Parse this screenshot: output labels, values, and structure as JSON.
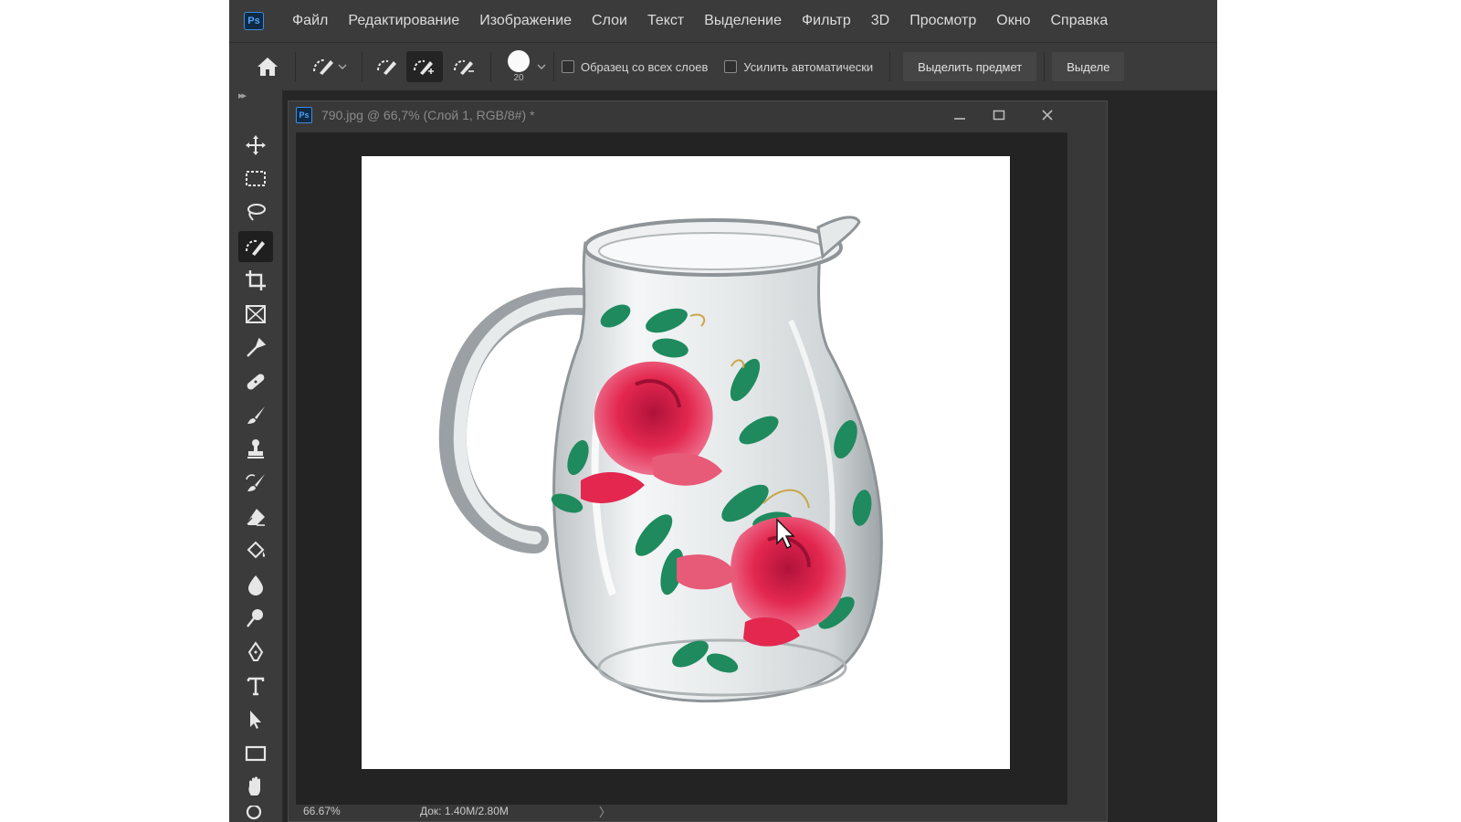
{
  "app": {
    "logo": "Ps"
  },
  "menu": [
    "Файл",
    "Редактирование",
    "Изображение",
    "Слои",
    "Текст",
    "Выделение",
    "Фильтр",
    "3D",
    "Просмотр",
    "Окно",
    "Справка"
  ],
  "options": {
    "brush_size": "20",
    "sample_all_layers": "Образец со всех слоев",
    "auto_enhance": "Усилить автоматически",
    "select_subject": "Выделить предмет",
    "select_mask": "Выделе"
  },
  "tools": [
    "move",
    "marquee",
    "lasso",
    "quick-selection",
    "crop",
    "frame",
    "eyedropper",
    "healing-brush",
    "brush",
    "clone-stamp",
    "history-brush",
    "eraser",
    "paint-bucket",
    "blur",
    "dodge",
    "pen",
    "type",
    "path-selection",
    "rectangle",
    "hand"
  ],
  "document": {
    "title": "790.jpg @ 66,7% (Слой 1, RGB/8#) *",
    "zoom": "66.67%",
    "doc_size": "Док: 1.40M/2.80M",
    "status_arrow": "〉"
  },
  "colors": {
    "rose": "#e3274f",
    "leaf": "#1e8a5e",
    "ui_dark": "#3b3b3b"
  }
}
